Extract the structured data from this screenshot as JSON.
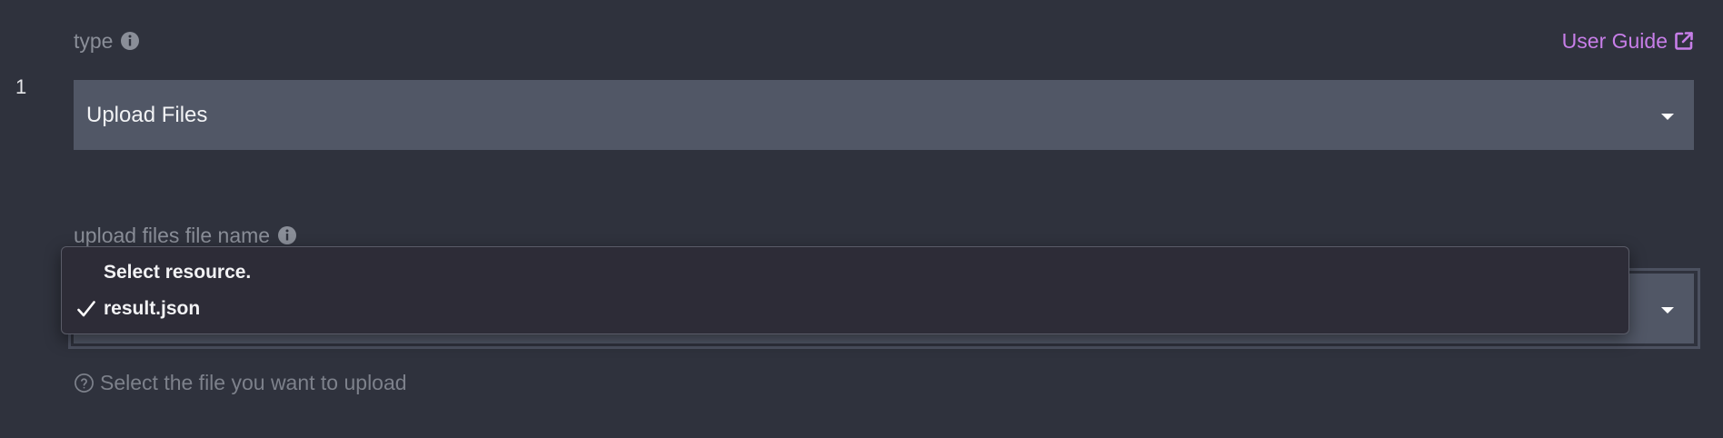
{
  "step": {
    "number": "1"
  },
  "type_field": {
    "label": "type",
    "selected_value": "Upload Files"
  },
  "user_guide": {
    "label": "User Guide"
  },
  "upload_field": {
    "label": "upload files file name",
    "helper_text": "Select the file you want to upload"
  },
  "dropdown": {
    "options": [
      {
        "label": "Select resource.",
        "selected": false
      },
      {
        "label": "result.json",
        "selected": true
      }
    ]
  },
  "colors": {
    "background": "#2f323d",
    "select_bg": "#515766",
    "link": "#c77ee8",
    "label": "#8a8e98",
    "dropdown_bg": "#2d2c37"
  },
  "icons": {
    "type_info": "info-icon",
    "upload_info": "info-icon",
    "user_guide": "external-link-icon",
    "helper": "question-circle-icon",
    "selected_option": "checkmark-icon",
    "select_caret": "caret-down-icon"
  }
}
